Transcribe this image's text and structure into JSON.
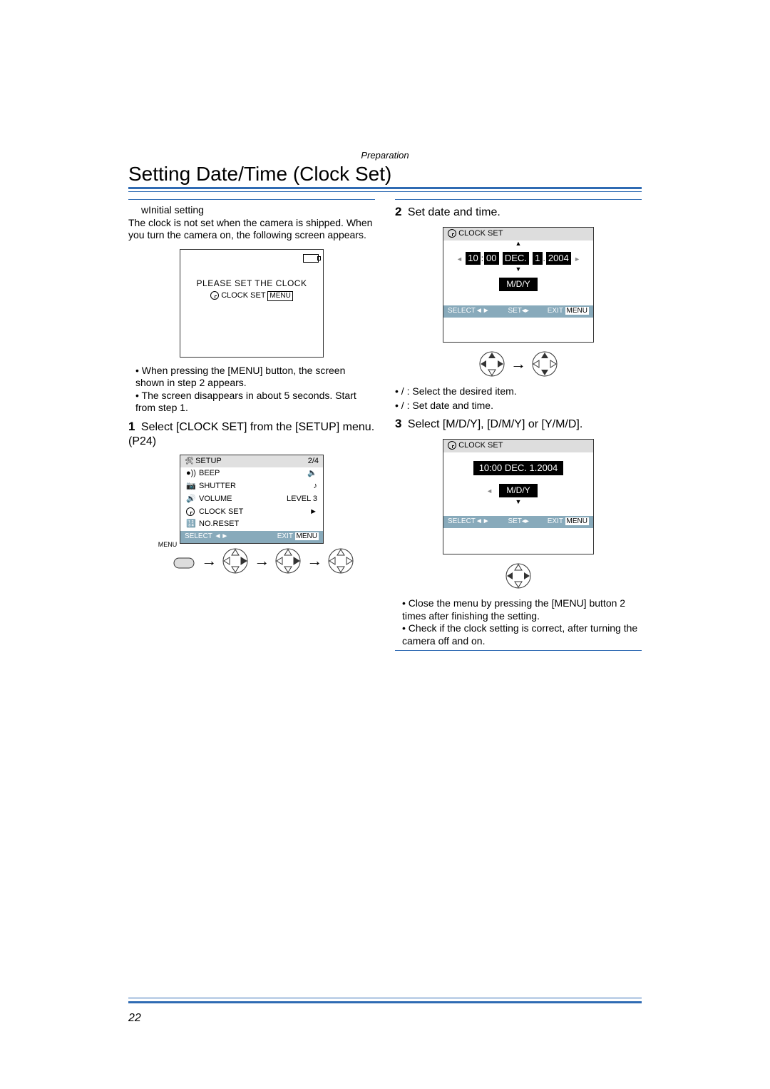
{
  "header": {
    "section": "Preparation",
    "title": "Setting Date/Time (Clock Set)"
  },
  "left": {
    "initial_label": "wInitial setting",
    "intro": "The clock is not set when the camera is shipped. When you turn the camera on, the following screen appears.",
    "prompt_screen": {
      "msg": "PLEASE SET THE CLOCK",
      "line2_a": "CLOCK SET",
      "line2_b": "MENU"
    },
    "after_prompt": [
      "When pressing the [MENU] button, the screen shown in step 2 appears.",
      "The screen disappears in about 5 seconds. Start from step 1."
    ],
    "step1_num": "1",
    "step1": "Select [CLOCK SET] from the [SETUP] menu. (P24)",
    "setup_menu": {
      "title": "SETUP",
      "page": "2/4",
      "rows": [
        {
          "label": "BEEP",
          "value": ""
        },
        {
          "label": "SHUTTER",
          "value": ""
        },
        {
          "label": "VOLUME",
          "value": "LEVEL 3"
        },
        {
          "label": "CLOCK SET",
          "value": "►"
        },
        {
          "label": "NO.RESET",
          "value": ""
        }
      ],
      "foot_l": "SELECT",
      "foot_r_a": "EXIT",
      "foot_r_b": "MENU"
    },
    "menu_label": "MENU"
  },
  "right": {
    "step2_num": "2",
    "step2": "Set date and time.",
    "clock_set_a": {
      "title": "CLOCK SET",
      "hh": "10",
      "mm": "00",
      "mon": "DEC.",
      "day": "1",
      "year": "2004",
      "format": "M/D/Y",
      "foot_l": "SELECT",
      "foot_m": "SET",
      "foot_r_a": "EXIT",
      "foot_r_b": "MENU"
    },
    "legend": [
      "   /    : Select the desired item.",
      "   /    : Set date and time."
    ],
    "step3_num": "3",
    "step3": "Select [M/D/Y], [D/M/Y] or [Y/M/D].",
    "clock_set_b": {
      "title": "CLOCK SET",
      "line": "10:00  DEC.  1.2004",
      "format": "M/D/Y",
      "foot_l": "SELECT",
      "foot_m": "SET",
      "foot_r_a": "EXIT",
      "foot_r_b": "MENU"
    },
    "closing": [
      "Close the menu by pressing the [MENU] button 2 times after finishing the setting.",
      "Check if the clock setting is correct, after turning the camera off and on."
    ]
  },
  "page_number": "22"
}
